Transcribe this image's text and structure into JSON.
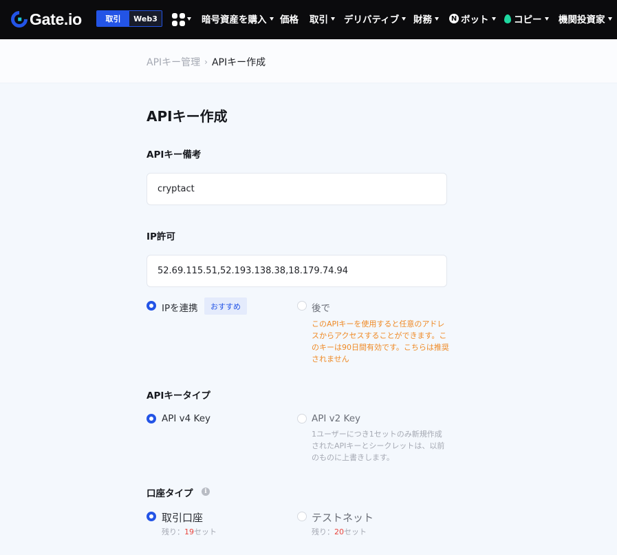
{
  "nav": {
    "logo_text": "Gate.io",
    "mode_trade": "取引",
    "mode_web3": "Web3",
    "items": {
      "buy_crypto": "暗号資産を購入",
      "prices": "価格",
      "trade": "取引",
      "derivatives": "デリバティブ",
      "finance": "財務",
      "bot_badge": "N",
      "bot": "ボット",
      "copy": "コピー",
      "institutional": "機関投資家"
    }
  },
  "breadcrumb": {
    "parent": "APIキー管理",
    "separator": "›",
    "current": "APIキー作成"
  },
  "form": {
    "title": "APIキー作成",
    "note_label": "APIキー備考",
    "note_value": "cryptact",
    "ip_label": "IP許可",
    "ip_value": "52.69.115.51,52.193.138.38,18.179.74.94",
    "ip_options": {
      "bind_label": "IPを連携",
      "bind_tag": "おすすめ",
      "later_label": "後で",
      "later_warning": "このAPIキーを使用すると任意のアドレスからアクセスすることができます。このキーは90日間有効です。こちらは推奨されません"
    },
    "key_type_label": "APIキータイプ",
    "key_type_options": {
      "v4_label": "API v4 Key",
      "v2_label": "API v2 Key",
      "v2_note": "1ユーザーにつき1セットのみ新規作成されたAPIキーとシークレットは、以前のものに上書きします。"
    },
    "account_type_label": "口座タイプ",
    "account_info_icon": "i",
    "account_options": {
      "trade_label": "取引口座",
      "trade_remain_prefix": "残り：",
      "trade_remain_count": "19",
      "trade_remain_suffix": "セット",
      "test_label": "テストネット",
      "test_remain_prefix": "残り：",
      "test_remain_count": "20",
      "test_remain_suffix": "セット"
    }
  },
  "colors": {
    "accent": "#2354e6",
    "warning": "#ef8a26",
    "count": "#e8443d"
  }
}
